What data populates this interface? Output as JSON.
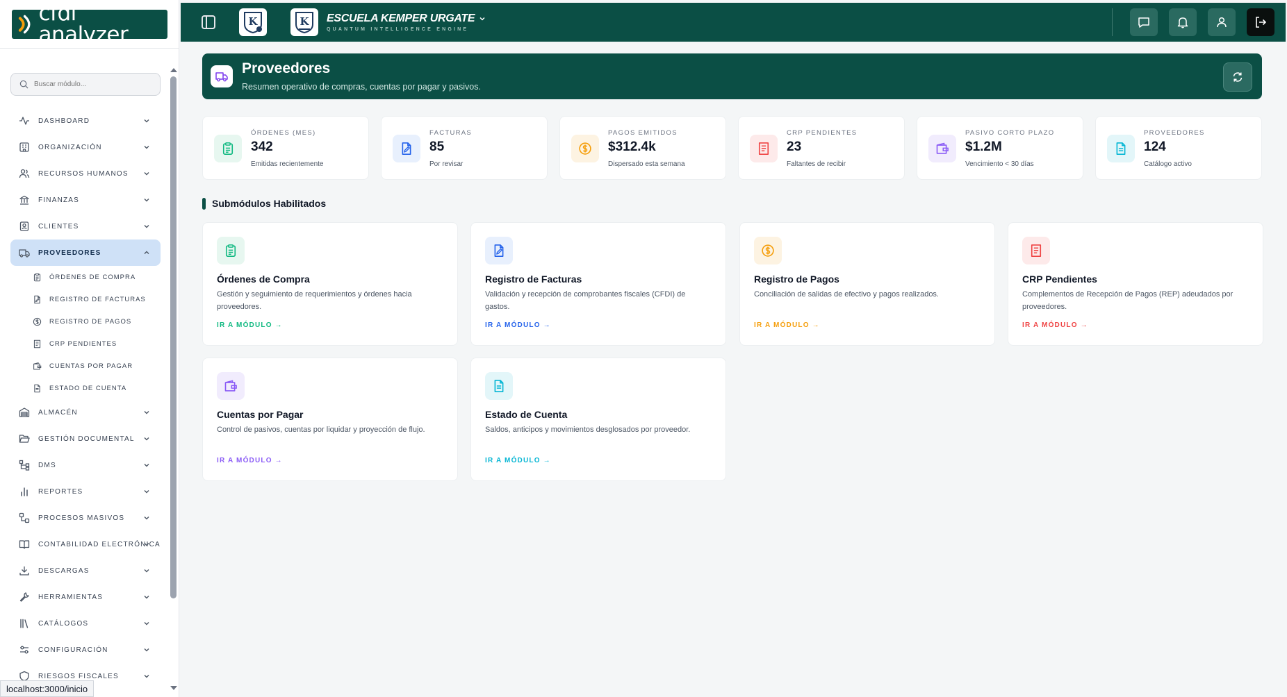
{
  "app": {
    "logo_text": "cfdi analyzer"
  },
  "sidebar": {
    "search_placeholder": "Buscar módulo...",
    "items": [
      {
        "label": "DASHBOARD",
        "icon": "activity-icon"
      },
      {
        "label": "ORGANIZACIÓN",
        "icon": "building-icon"
      },
      {
        "label": "RECURSOS HUMANOS",
        "icon": "users-icon"
      },
      {
        "label": "FINANZAS",
        "icon": "bank-icon"
      },
      {
        "label": "CLIENTES",
        "icon": "contact-icon"
      },
      {
        "label": "PROVEEDORES",
        "icon": "truck-icon"
      },
      {
        "label": "ALMACÉN",
        "icon": "warehouse-icon"
      },
      {
        "label": "GESTIÓN DOCUMENTAL",
        "icon": "folder-open-icon"
      },
      {
        "label": "DMS",
        "icon": "network-icon"
      },
      {
        "label": "REPORTES",
        "icon": "bar-chart-icon"
      },
      {
        "label": "PROCESOS MASIVOS",
        "icon": "workflow-icon"
      },
      {
        "label": "CONTABILIDAD ELECTRÓNICA",
        "icon": "book-open-icon"
      },
      {
        "label": "DESCARGAS",
        "icon": "download-icon"
      },
      {
        "label": "HERRAMIENTAS",
        "icon": "wrench-icon"
      },
      {
        "label": "CATÁLOGOS",
        "icon": "library-icon"
      },
      {
        "label": "CONFIGURACIÓN",
        "icon": "sliders-icon"
      },
      {
        "label": "RIESGOS FISCALES",
        "icon": "shield-icon"
      }
    ],
    "subitems": [
      {
        "label": "ÓRDENES DE COMPRA",
        "icon": "clipboard-icon"
      },
      {
        "label": "REGISTRO DE FACTURAS",
        "icon": "file-edit-icon"
      },
      {
        "label": "REGISTRO DE PAGOS",
        "icon": "dollar-circle-icon"
      },
      {
        "label": "CRP PENDIENTES",
        "icon": "receipt-icon"
      },
      {
        "label": "CUENTAS POR PAGAR",
        "icon": "wallet-icon"
      },
      {
        "label": "ESTADO DE CUENTA",
        "icon": "file-text-icon"
      }
    ],
    "status_url": "localhost:3000/inicio"
  },
  "topbar": {
    "school_name": "ESCUELA KEMPER URGATE",
    "school_subtitle": "QUANTUM INTELLIGENCE ENGINE",
    "logo_letter": "K"
  },
  "hero": {
    "title": "Proveedores",
    "subtitle": "Resumen operativo de compras, cuentas por pagar y pasivos."
  },
  "kpis": [
    {
      "label": "ÓRDENES (MES)",
      "value": "342",
      "note": "Emitidas recientemente",
      "color": "#10b981",
      "bg": "#e7f7f0",
      "icon": "clipboard-icon"
    },
    {
      "label": "FACTURAS",
      "value": "85",
      "note": "Por revisar",
      "color": "#2563eb",
      "bg": "#e8f0fd",
      "icon": "file-edit-icon"
    },
    {
      "label": "PAGOS EMITIDOS",
      "value": "$312.4k",
      "note": "Dispersado esta semana",
      "color": "#f59e0b",
      "bg": "#fdf3e2",
      "icon": "dollar-circle-icon"
    },
    {
      "label": "CRP PENDIENTES",
      "value": "23",
      "note": "Faltantes de recibir",
      "color": "#ef4444",
      "bg": "#fdeaea",
      "icon": "receipt-icon"
    },
    {
      "label": "PASIVO CORTO PLAZO",
      "value": "$1.2M",
      "note": "Vencimiento < 30 días",
      "color": "#8b5cf6",
      "bg": "#f1ecfd",
      "icon": "wallet-icon"
    },
    {
      "label": "PROVEEDORES",
      "value": "124",
      "note": "Catálogo activo",
      "color": "#06b6d4",
      "bg": "#e3f6f9",
      "icon": "file-text-icon"
    }
  ],
  "section_title": "Submódulos Habilitados",
  "cards": [
    {
      "title": "Órdenes de Compra",
      "desc": "Gestión y seguimiento de requerimientos y órdenes hacia proveedores.",
      "link": "IR A MÓDULO",
      "color": "#10b981",
      "bg": "#e7f7f0",
      "icon": "clipboard-icon"
    },
    {
      "title": "Registro de Facturas",
      "desc": "Validación y recepción de comprobantes fiscales (CFDI) de gastos.",
      "link": "IR A MÓDULO",
      "color": "#2563eb",
      "bg": "#e8f0fd",
      "icon": "file-edit-icon"
    },
    {
      "title": "Registro de Pagos",
      "desc": "Conciliación de salidas de efectivo y pagos realizados.",
      "link": "IR A MÓDULO",
      "color": "#f59e0b",
      "bg": "#fdf3e2",
      "icon": "dollar-circle-icon"
    },
    {
      "title": "CRP Pendientes",
      "desc": "Complementos de Recepción de Pagos (REP) adeudados por proveedores.",
      "link": "IR A MÓDULO",
      "color": "#ef4444",
      "bg": "#fdeaea",
      "icon": "receipt-icon"
    },
    {
      "title": "Cuentas por Pagar",
      "desc": "Control de pasivos, cuentas por liquidar y proyección de flujo.",
      "link": "IR A MÓDULO",
      "color": "#8b5cf6",
      "bg": "#f1ecfd",
      "icon": "wallet-icon"
    },
    {
      "title": "Estado de Cuenta",
      "desc": "Saldos, anticipos y movimientos desglosados por proveedor.",
      "link": "IR A MÓDULO",
      "color": "#06b6d4",
      "bg": "#e3f6f9",
      "icon": "file-text-icon"
    }
  ]
}
